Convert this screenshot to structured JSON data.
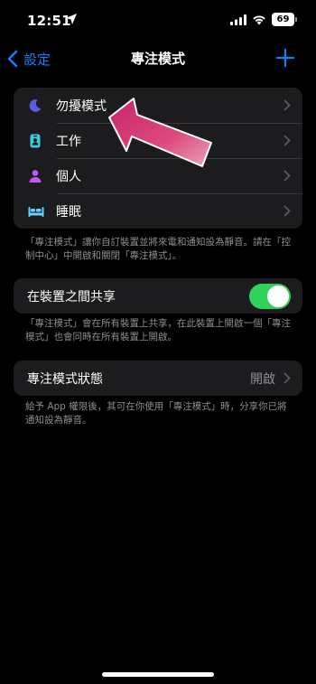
{
  "status_bar": {
    "time": "12:51",
    "battery": "69"
  },
  "nav": {
    "back_label": "設定",
    "title": "專注模式"
  },
  "focus_modes": [
    {
      "label": "勿擾模式",
      "icon": "moon-icon",
      "color": "#5e5ce6"
    },
    {
      "label": "工作",
      "icon": "id-badge-icon",
      "color": "#40c8e0"
    },
    {
      "label": "個人",
      "icon": "person-icon",
      "color": "#bf5af2"
    },
    {
      "label": "睡眠",
      "icon": "bed-icon",
      "color": "#64d2ff"
    }
  ],
  "focus_modes_footnote": "「專注模式」讓你自訂裝置並將來電和通知設為靜音。請在「控制中心」中開啟和關閉「專注模式」。",
  "share_across_devices": {
    "label": "在裝置之間共享",
    "enabled": true,
    "footnote": "「專注模式」會在所有裝置上共享，在此裝置上開啟一個「專注模式」也會同時在所有裝置上開啟。"
  },
  "focus_status": {
    "label": "專注模式狀態",
    "value": "開啟",
    "footnote": "給予 App 權限後，其可在你使用「專注模式」時，分享你已將通知設為靜音。"
  },
  "colors": {
    "accent": "#0a84ff",
    "toggle_on": "#30d158",
    "annotation_arrow": "#d6326e"
  }
}
